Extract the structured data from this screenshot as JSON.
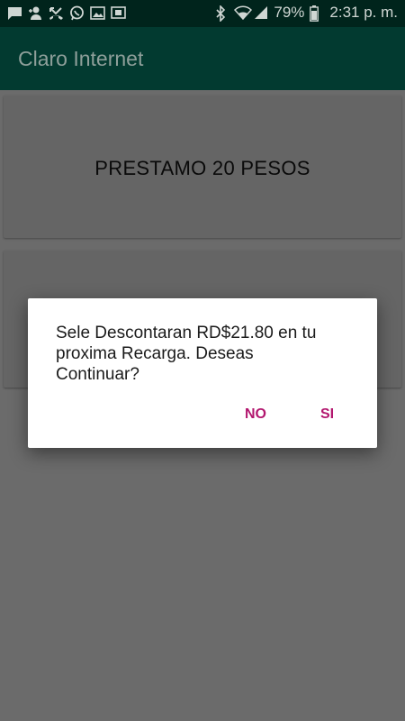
{
  "status_bar": {
    "battery": "79%",
    "time": "2:31 p. m.",
    "left_icons": [
      "message-icon",
      "person-add-icon",
      "missed-call-icon",
      "whatsapp-icon",
      "image-icon",
      "screen-icon"
    ],
    "right_icons": [
      "bluetooth-icon",
      "wifi-icon",
      "signal-icon",
      "battery-icon"
    ]
  },
  "app_bar": {
    "title": "Claro Internet"
  },
  "main": {
    "cards": [
      {
        "label": "PRESTAMO 20 PESOS"
      },
      {
        "label": ""
      }
    ]
  },
  "dialog": {
    "message": "Sele Descontaran RD$21.80 en tu proxima Recarga. Deseas Continuar?",
    "no_label": "NO",
    "yes_label": "SI"
  },
  "colors": {
    "status_bar_bg": "#00241c",
    "app_bar_bg": "#023a30",
    "accent": "#b2166e",
    "dim_background": "#6b6b6b"
  }
}
